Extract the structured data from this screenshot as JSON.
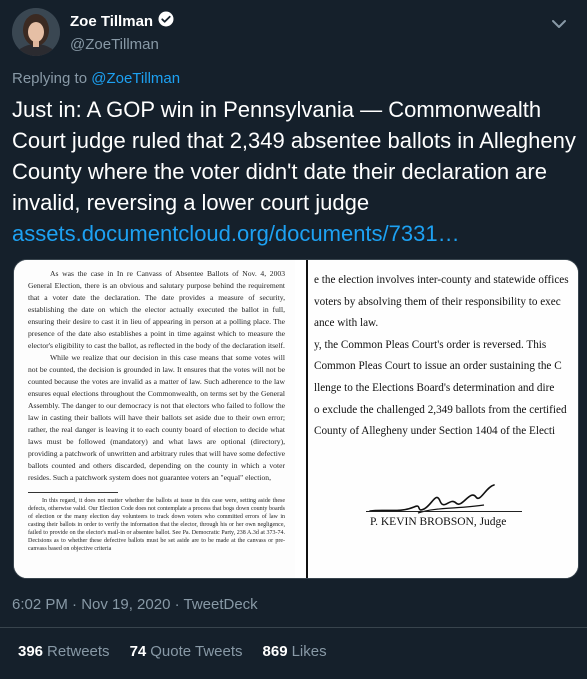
{
  "tweet": {
    "display_name": "Zoe Tillman",
    "handle": "@ZoeTillman",
    "replying_prefix": "Replying to",
    "replying_to": "@ZoeTillman",
    "text": "Just in: A GOP win in Pennsylvania — Commonwealth Court judge ruled that 2,349 absentee ballots in Allegheny County where the voter didn't date their declaration are invalid, reversing a lower court judge",
    "link": "assets.documentcloud.org/documents/7331…",
    "timestamp": "6:02 PM · Nov 19, 2020 · TweetDeck",
    "verified_icon": "verified-badge-icon",
    "more_icon": "chevron-down-icon"
  },
  "stats": {
    "retweets_count": "396",
    "retweets_label": "Retweets",
    "quote_count": "74",
    "quote_label": "Quote Tweets",
    "likes_count": "869",
    "likes_label": "Likes"
  },
  "document": {
    "left_page": {
      "para1": "As was the case in In re Canvass of Absentee Ballots of Nov. 4, 2003 General Election, there is an obvious and salutary purpose behind the requirement that a voter date the declaration. The date provides a measure of security, establishing the date on which the elector actually executed the ballot in full, ensuring their desire to cast it in lieu of appearing in person at a polling place. The presence of the date also establishes a point in time against which to measure the elector's eligibility to cast the ballot, as reflected in the body of the declaration itself.",
      "para2": "While we realize that our decision in this case means that some votes will not be counted, the decision is grounded in law. It ensures that the votes will not be counted because the votes are invalid as a matter of law. Such adherence to the law ensures equal elections throughout the Commonwealth, on terms set by the General Assembly. The danger to our democracy is not that electors who failed to follow the law in casting their ballots will have their ballots set aside due to their own error; rather, the real danger is leaving it to each county board of election to decide what laws must be followed (mandatory) and what laws are optional (directory), providing a patchwork of unwritten and arbitrary rules that will have some defective ballots counted and others discarded, depending on the county in which a voter resides. Such a patchwork system does not guarantee voters an \"equal\" election,",
      "footnote": "In this regard, it does not matter whether the ballots at issue in this case were, setting aside these defects, otherwise valid. Our Election Code does not contemplate a process that bogs down county boards of election or the many election day volunteers to track down voters who committed errors of law in casting their ballots in order to verify the information that the elector, through his or her own negligence, failed to provide on the elector's mail-in or absentee ballot. See Pa. Democratic Party, 238 A.3d at 373-74. Decisions as to whether these defective ballots must be set aside are to be made at the canvass or pre-canvass based on objective criteria"
    },
    "right_page": {
      "lines": [
        "e the election involves inter-county and statewide offices",
        "voters by absolving them of their responsibility to exec",
        "ance with law.",
        "y, the Common Pleas Court's order is reversed.  This",
        "Common Pleas Court to issue an order sustaining the C",
        "llenge to the Elections Board's determination and dire",
        "o exclude the challenged 2,349 ballots from the certified",
        "County of Allegheny under Section 1404 of the Electi"
      ],
      "judge": "P. KEVIN BROBSON, Judge"
    }
  }
}
